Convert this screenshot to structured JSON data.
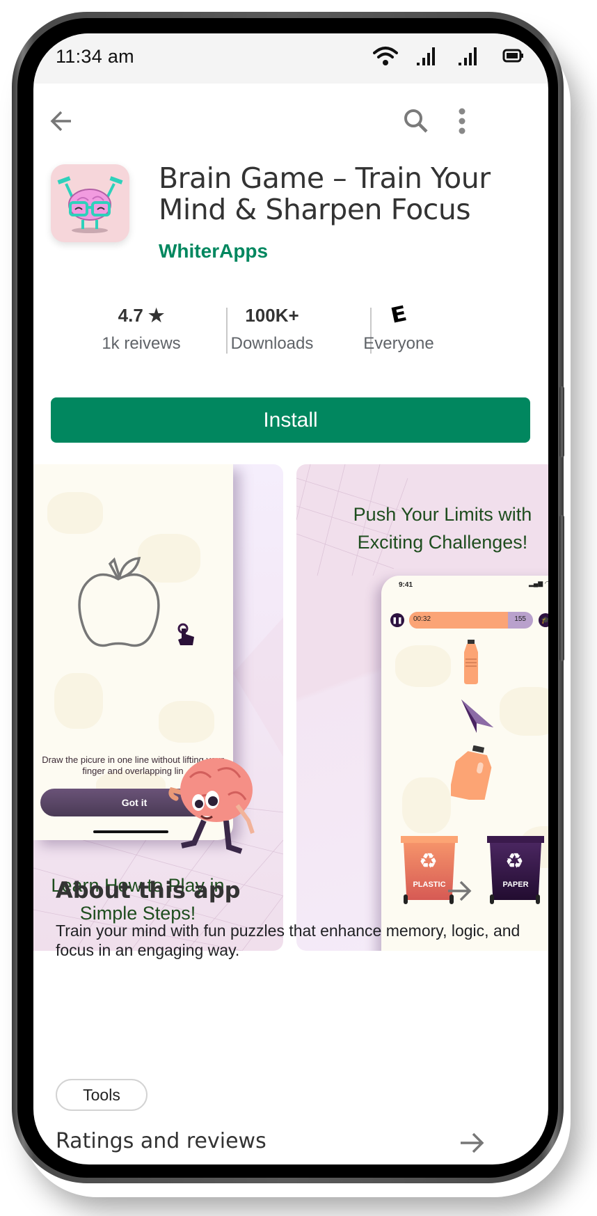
{
  "status_bar": {
    "time": "11:34 am",
    "icons": [
      "wifi-icon",
      "signal-icon",
      "signal-icon",
      "battery-icon"
    ]
  },
  "app_bar": {
    "back_icon": "arrow-left-icon",
    "search_icon": "search-icon",
    "more_icon": "more-vertical-icon"
  },
  "app": {
    "title": "Brain Game – Train Your Mind & Sharpen Focus",
    "developer": "WhiterApps",
    "icon": "brain-lifting-dumbbells-icon",
    "accent_color": "#01875f"
  },
  "stats": [
    {
      "value": "4.7",
      "value_icon": "star-icon",
      "label": "1k reivews"
    },
    {
      "value": "100K+",
      "label": "Downloads"
    },
    {
      "value": "E",
      "value_icon": "esrb-everyone-icon",
      "label": "Everyone"
    }
  ],
  "install_button": {
    "label": "Install"
  },
  "screenshots": [
    {
      "caption": "Learn How to Play in Simple Steps!",
      "instruction": "Draw the picure in one line without lifting your finger and overlapping lin",
      "button": "Got it",
      "illustrations": [
        "apple-outline-icon",
        "tap-hand-icon",
        "brain-mascot-icon"
      ]
    },
    {
      "caption": "Push Your Limits with Exciting Challenges!",
      "inner_time": "9:41",
      "timer": "00:32",
      "score": "155",
      "timer_progress": 0.8,
      "bins": [
        "PLASTIC",
        "PAPER"
      ],
      "illustrations": [
        "plastic-bottle-icon",
        "paper-plane-icon",
        "plastic-jug-icon",
        "recycle-icon"
      ]
    }
  ],
  "about": {
    "title": "About this app",
    "description": "Train your mind with fun puzzles that enhance memory, logic, and focus in an engaging way.",
    "category_chip": "Tools"
  },
  "ratings": {
    "title": "Ratings and reviews"
  }
}
